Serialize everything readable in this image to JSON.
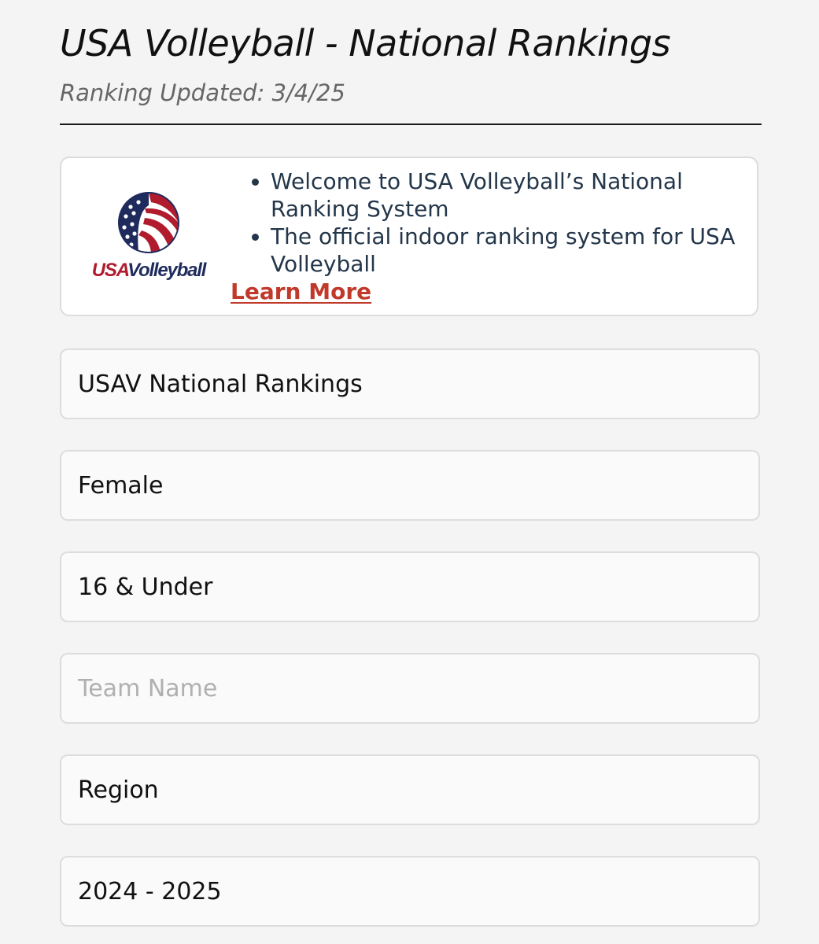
{
  "header": {
    "title": "USA Volleyball - National Rankings",
    "updated": "Ranking Updated: 3/4/25"
  },
  "info_card": {
    "logo": {
      "icon": "usa-volleyball-logo",
      "text_usa": "USA",
      "text_volleyball": "Volleyball"
    },
    "bullets": [
      "Welcome to USA Volleyball’s National Ranking System",
      "The official indoor ranking system for USA Volleyball"
    ],
    "learn_more": "Learn More"
  },
  "filters": {
    "ranking_type": "USAV National Rankings",
    "gender": "Female",
    "age_group": "16 & Under",
    "team_name_placeholder": "Team Name",
    "team_name_value": "",
    "region": "Region",
    "season": "2024 - 2025"
  },
  "colors": {
    "link": "#c0392b",
    "bullet_text": "#23364a",
    "brand_red": "#b01c2e",
    "brand_navy": "#1f2b5c"
  }
}
